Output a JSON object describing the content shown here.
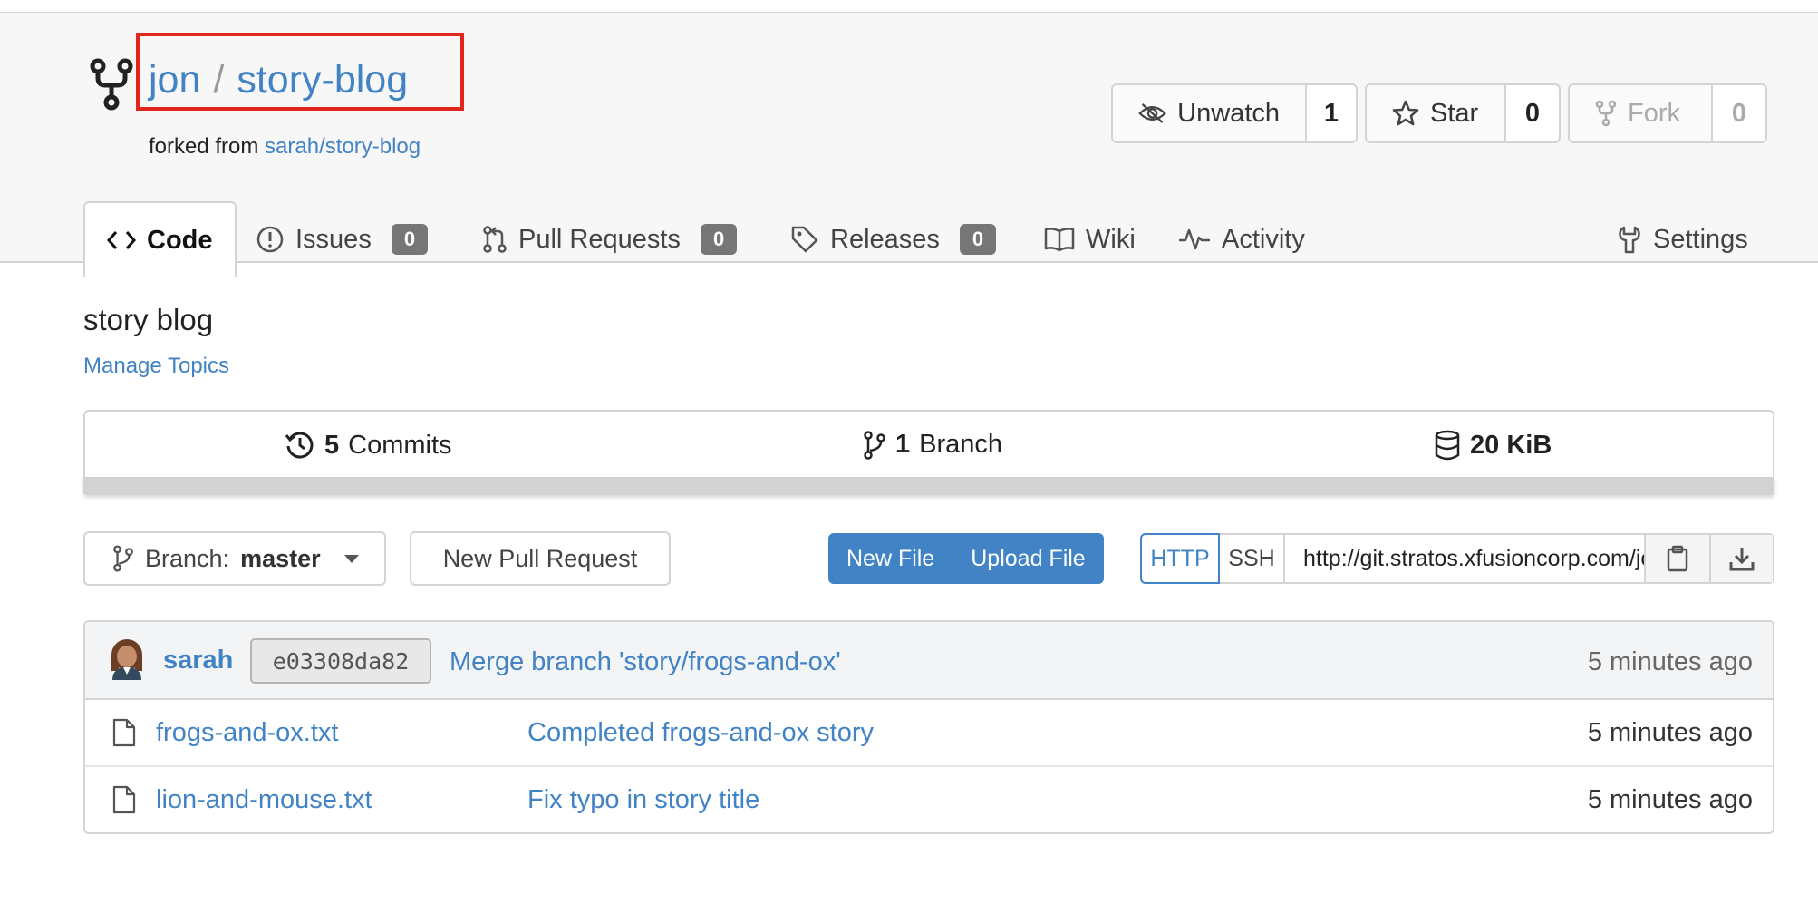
{
  "repo": {
    "owner": "jon",
    "separator": "/",
    "name": "story-blog",
    "forked_from_prefix": "forked from",
    "forked_from": "sarah/story-blog"
  },
  "actions": {
    "watch": {
      "label": "Unwatch",
      "count": "1"
    },
    "star": {
      "label": "Star",
      "count": "0"
    },
    "fork": {
      "label": "Fork",
      "count": "0"
    }
  },
  "tabs": [
    {
      "label": "Code",
      "icon": "code-icon",
      "active": true
    },
    {
      "label": "Issues",
      "icon": "issue-icon",
      "badge": "0"
    },
    {
      "label": "Pull Requests",
      "icon": "pull-request-icon",
      "badge": "0"
    },
    {
      "label": "Releases",
      "icon": "tag-icon",
      "badge": "0"
    },
    {
      "label": "Wiki",
      "icon": "book-icon"
    },
    {
      "label": "Activity",
      "icon": "pulse-icon"
    },
    {
      "label": "Settings",
      "icon": "tools-icon"
    }
  ],
  "description": "story blog",
  "manage_topics": "Manage Topics",
  "stats": {
    "commits_count": "5",
    "commits_label": "Commits",
    "branches_count": "1",
    "branches_label": "Branch",
    "size": "20 KiB"
  },
  "toolbar": {
    "branch_prefix": "Branch:",
    "branch_name": "master",
    "new_pull_request": "New Pull Request",
    "new_file": "New File",
    "upload_file": "Upload File",
    "http": "HTTP",
    "ssh": "SSH",
    "clone_url": "http://git.stratos.xfusioncorp.com/jon/story-blog.git"
  },
  "latest_commit": {
    "author": "sarah",
    "sha": "e03308da82",
    "message": "Merge branch 'story/frogs-and-ox'",
    "time": "5 minutes ago"
  },
  "files": [
    {
      "name": "frogs-and-ox.txt",
      "message": "Completed frogs-and-ox story",
      "time": "5 minutes ago"
    },
    {
      "name": "lion-and-mouse.txt",
      "message": "Fix typo in story title",
      "time": "5 minutes ago"
    }
  ],
  "colors": {
    "link": "#4183c4",
    "highlight": "#e0261d",
    "badge": "#767676",
    "header_bg": "#f7f7f7"
  }
}
